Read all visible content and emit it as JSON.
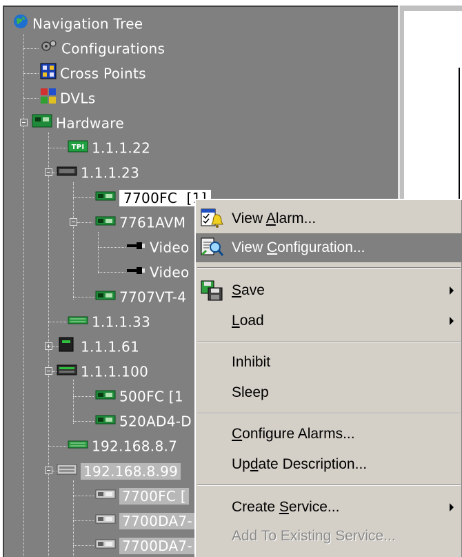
{
  "tree": {
    "root_label": "Navigation Tree",
    "nodes": {
      "configurations": "Configurations",
      "cross_points": "Cross Points",
      "dvls": "DVLs",
      "hardware": "Hardware",
      "n_1_1_1_22": "1.1.1.22",
      "n_1_1_1_23": "1.1.1.23",
      "n_7700fc": "7700FC",
      "n_7700fc_suffix": "[1]",
      "n_7761avm": "7761AVM",
      "video_1": "Video",
      "video_2": "Video",
      "n_7707vt": "7707VT-4",
      "n_1_1_1_33": "1.1.1.33",
      "n_1_1_1_61": "1.1.1.61",
      "n_1_1_1_100": "1.1.1.100",
      "n_500fc": "500FC  [1",
      "n_520ad4": "520AD4-D",
      "n_192_168_8_7": "192.168.8.7",
      "n_192_168_8_99": "192.168.8.99",
      "n_7700fc_b": "7700FC  [",
      "n_7700da7_a": "7700DA7-",
      "n_7700da7_b": "7700DA7-"
    }
  },
  "context_menu": {
    "items": [
      {
        "pre": "View ",
        "key": "A",
        "post": "larm...",
        "has_submenu": false,
        "icon": "view-alarm-icon"
      },
      {
        "pre": "View ",
        "key": "C",
        "post": "onfiguration...",
        "has_submenu": false,
        "icon": "view-configuration-icon",
        "active": true
      },
      {
        "pre": "",
        "key": "S",
        "post": "ave",
        "has_submenu": true,
        "icon": "save-icon"
      },
      {
        "pre": "",
        "key": "L",
        "post": "oad",
        "has_submenu": true
      },
      {
        "pre": "Inhibit",
        "key": "",
        "post": "",
        "has_submenu": false
      },
      {
        "pre": "Sleep",
        "key": "",
        "post": "",
        "has_submenu": false
      },
      {
        "pre": "",
        "key": "C",
        "post": "onfigure Alarms...",
        "has_submenu": false
      },
      {
        "pre": "Up",
        "key": "d",
        "post": "ate Description...",
        "has_submenu": false
      },
      {
        "pre": "Create ",
        "key": "S",
        "post": "ervice...",
        "has_submenu": true
      },
      {
        "pre": "Add To Existing Service...",
        "key": "",
        "post": "",
        "has_submenu": false,
        "disabled": true
      }
    ]
  },
  "colors": {
    "tree_background": "#808080",
    "menu_background": "#d4d0c8",
    "menu_highlight": "#808080"
  }
}
